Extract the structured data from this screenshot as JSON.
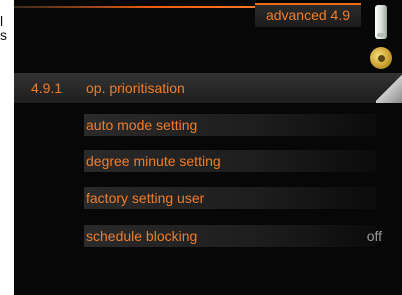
{
  "edge_text": [
    "l",
    "s"
  ],
  "header": {
    "title": "advanced 4.9"
  },
  "icons": {
    "thermometer": "thermometer-icon",
    "gear": "gear-icon"
  },
  "colors": {
    "accent": "#f07d2a",
    "background": "#070707",
    "muted": "#9a9a9a"
  },
  "menu": {
    "items": [
      {
        "number": "4.9.1",
        "label": "op. prioritisation",
        "value": ""
      },
      {
        "number": "",
        "label": "auto mode setting",
        "value": ""
      },
      {
        "number": "",
        "label": "degree minute setting",
        "value": ""
      },
      {
        "number": "",
        "label": "factory setting user",
        "value": ""
      },
      {
        "number": "",
        "label": "schedule blocking",
        "value": "off"
      }
    ]
  }
}
